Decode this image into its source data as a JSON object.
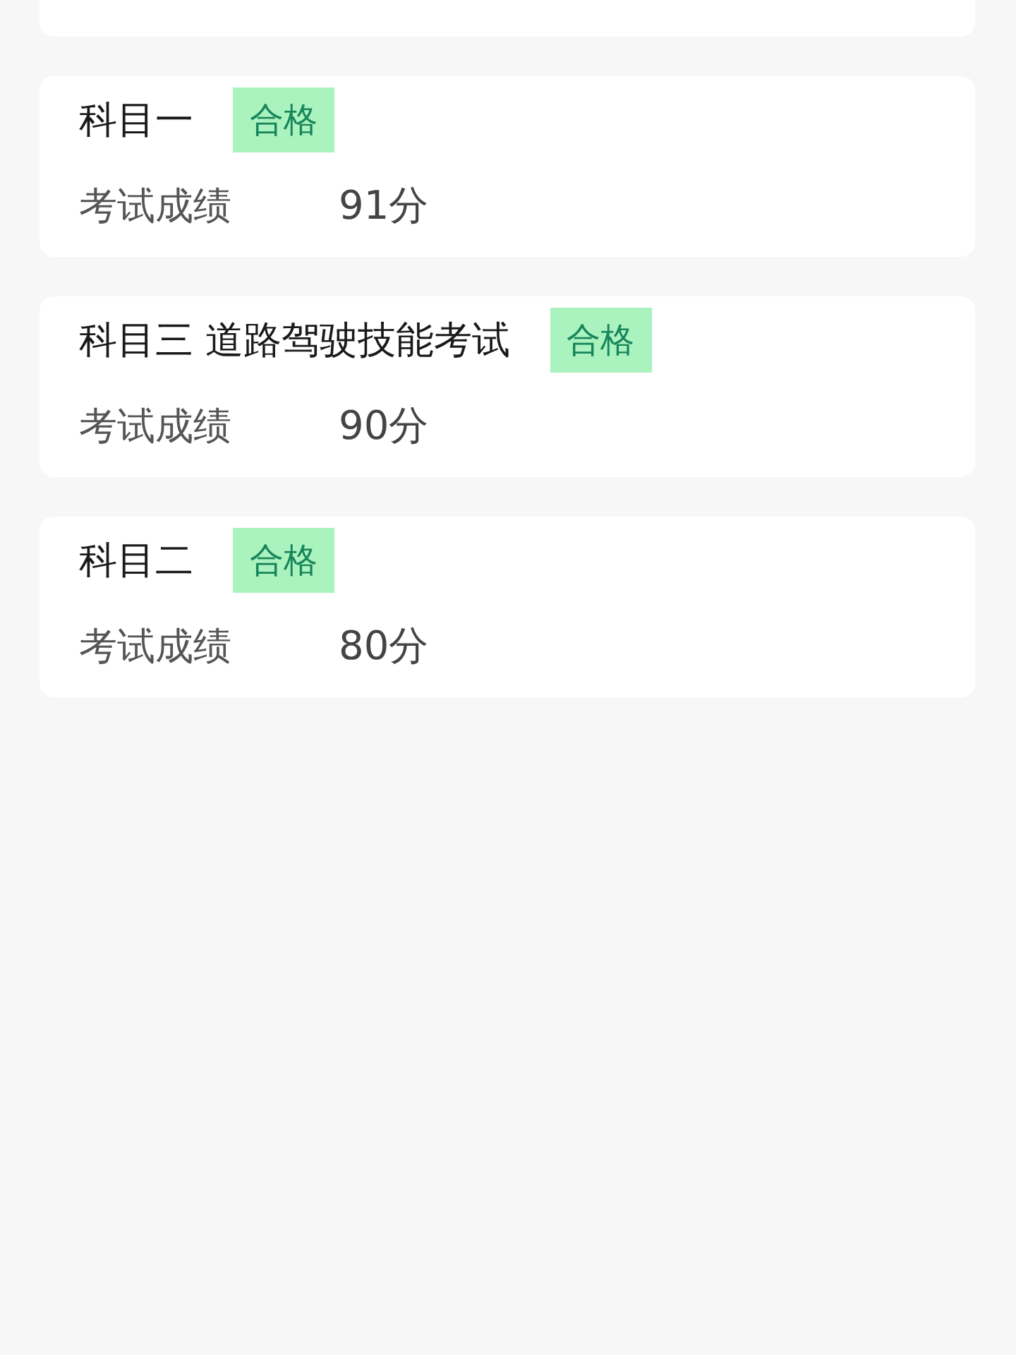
{
  "results": [
    {
      "subject": "科目一",
      "badge": "合格",
      "score_label": "考试成绩",
      "score": "91分"
    },
    {
      "subject": "科目三 道路驾驶技能考试",
      "badge": "合格",
      "score_label": "考试成绩",
      "score": "90分"
    },
    {
      "subject": "科目二",
      "badge": "合格",
      "score_label": "考试成绩",
      "score": "80分"
    }
  ]
}
